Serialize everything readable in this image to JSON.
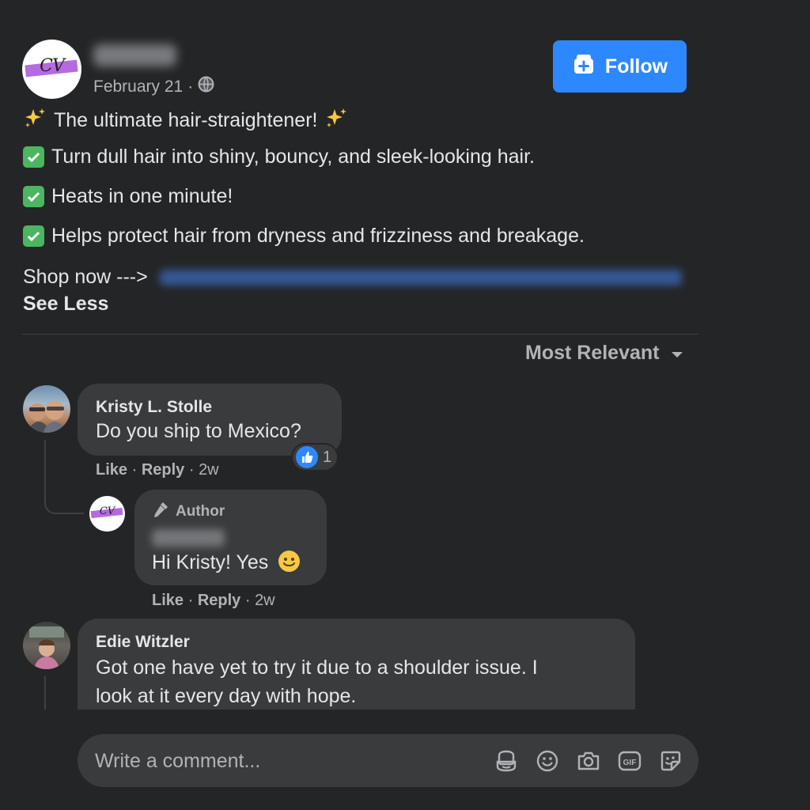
{
  "post": {
    "author_name": "Carway",
    "date": "February 21",
    "separator": "·",
    "audience_icon": "globe-icon",
    "follow_label": "Follow",
    "lines": [
      "The ultimate hair-straightener!",
      "Turn dull hair into shiny, bouncy, and sleek-looking hair.",
      "Heats in one minute!",
      "Helps protect hair from dryness and frizziness and breakage."
    ],
    "shop_label": "Shop now --->",
    "shop_link": "https://www.carwayshop.com/products/magic-comb",
    "see_less": "See Less"
  },
  "sort": {
    "label": "Most Relevant"
  },
  "comments": [
    {
      "author": "Kristy L. Stolle",
      "text": "Do you ship to Mexico?",
      "like": "Like",
      "reply": "Reply",
      "age": "2w",
      "reaction_count": "1",
      "reply_item": {
        "badge": "Author",
        "author": "Carway",
        "text": "Hi Kristy! Yes",
        "like": "Like",
        "reply": "Reply",
        "age": "2w"
      }
    },
    {
      "author": "Edie Witzler",
      "text_line1": "Got one have yet to try it due to a shoulder issue. I",
      "text_line2": "look at it every day with hope."
    }
  ],
  "composer": {
    "placeholder": "Write a comment..."
  },
  "colors": {
    "accent": "#2d88ff",
    "background": "#242526",
    "bubble": "#3a3b3c",
    "check": "#4cb560"
  }
}
